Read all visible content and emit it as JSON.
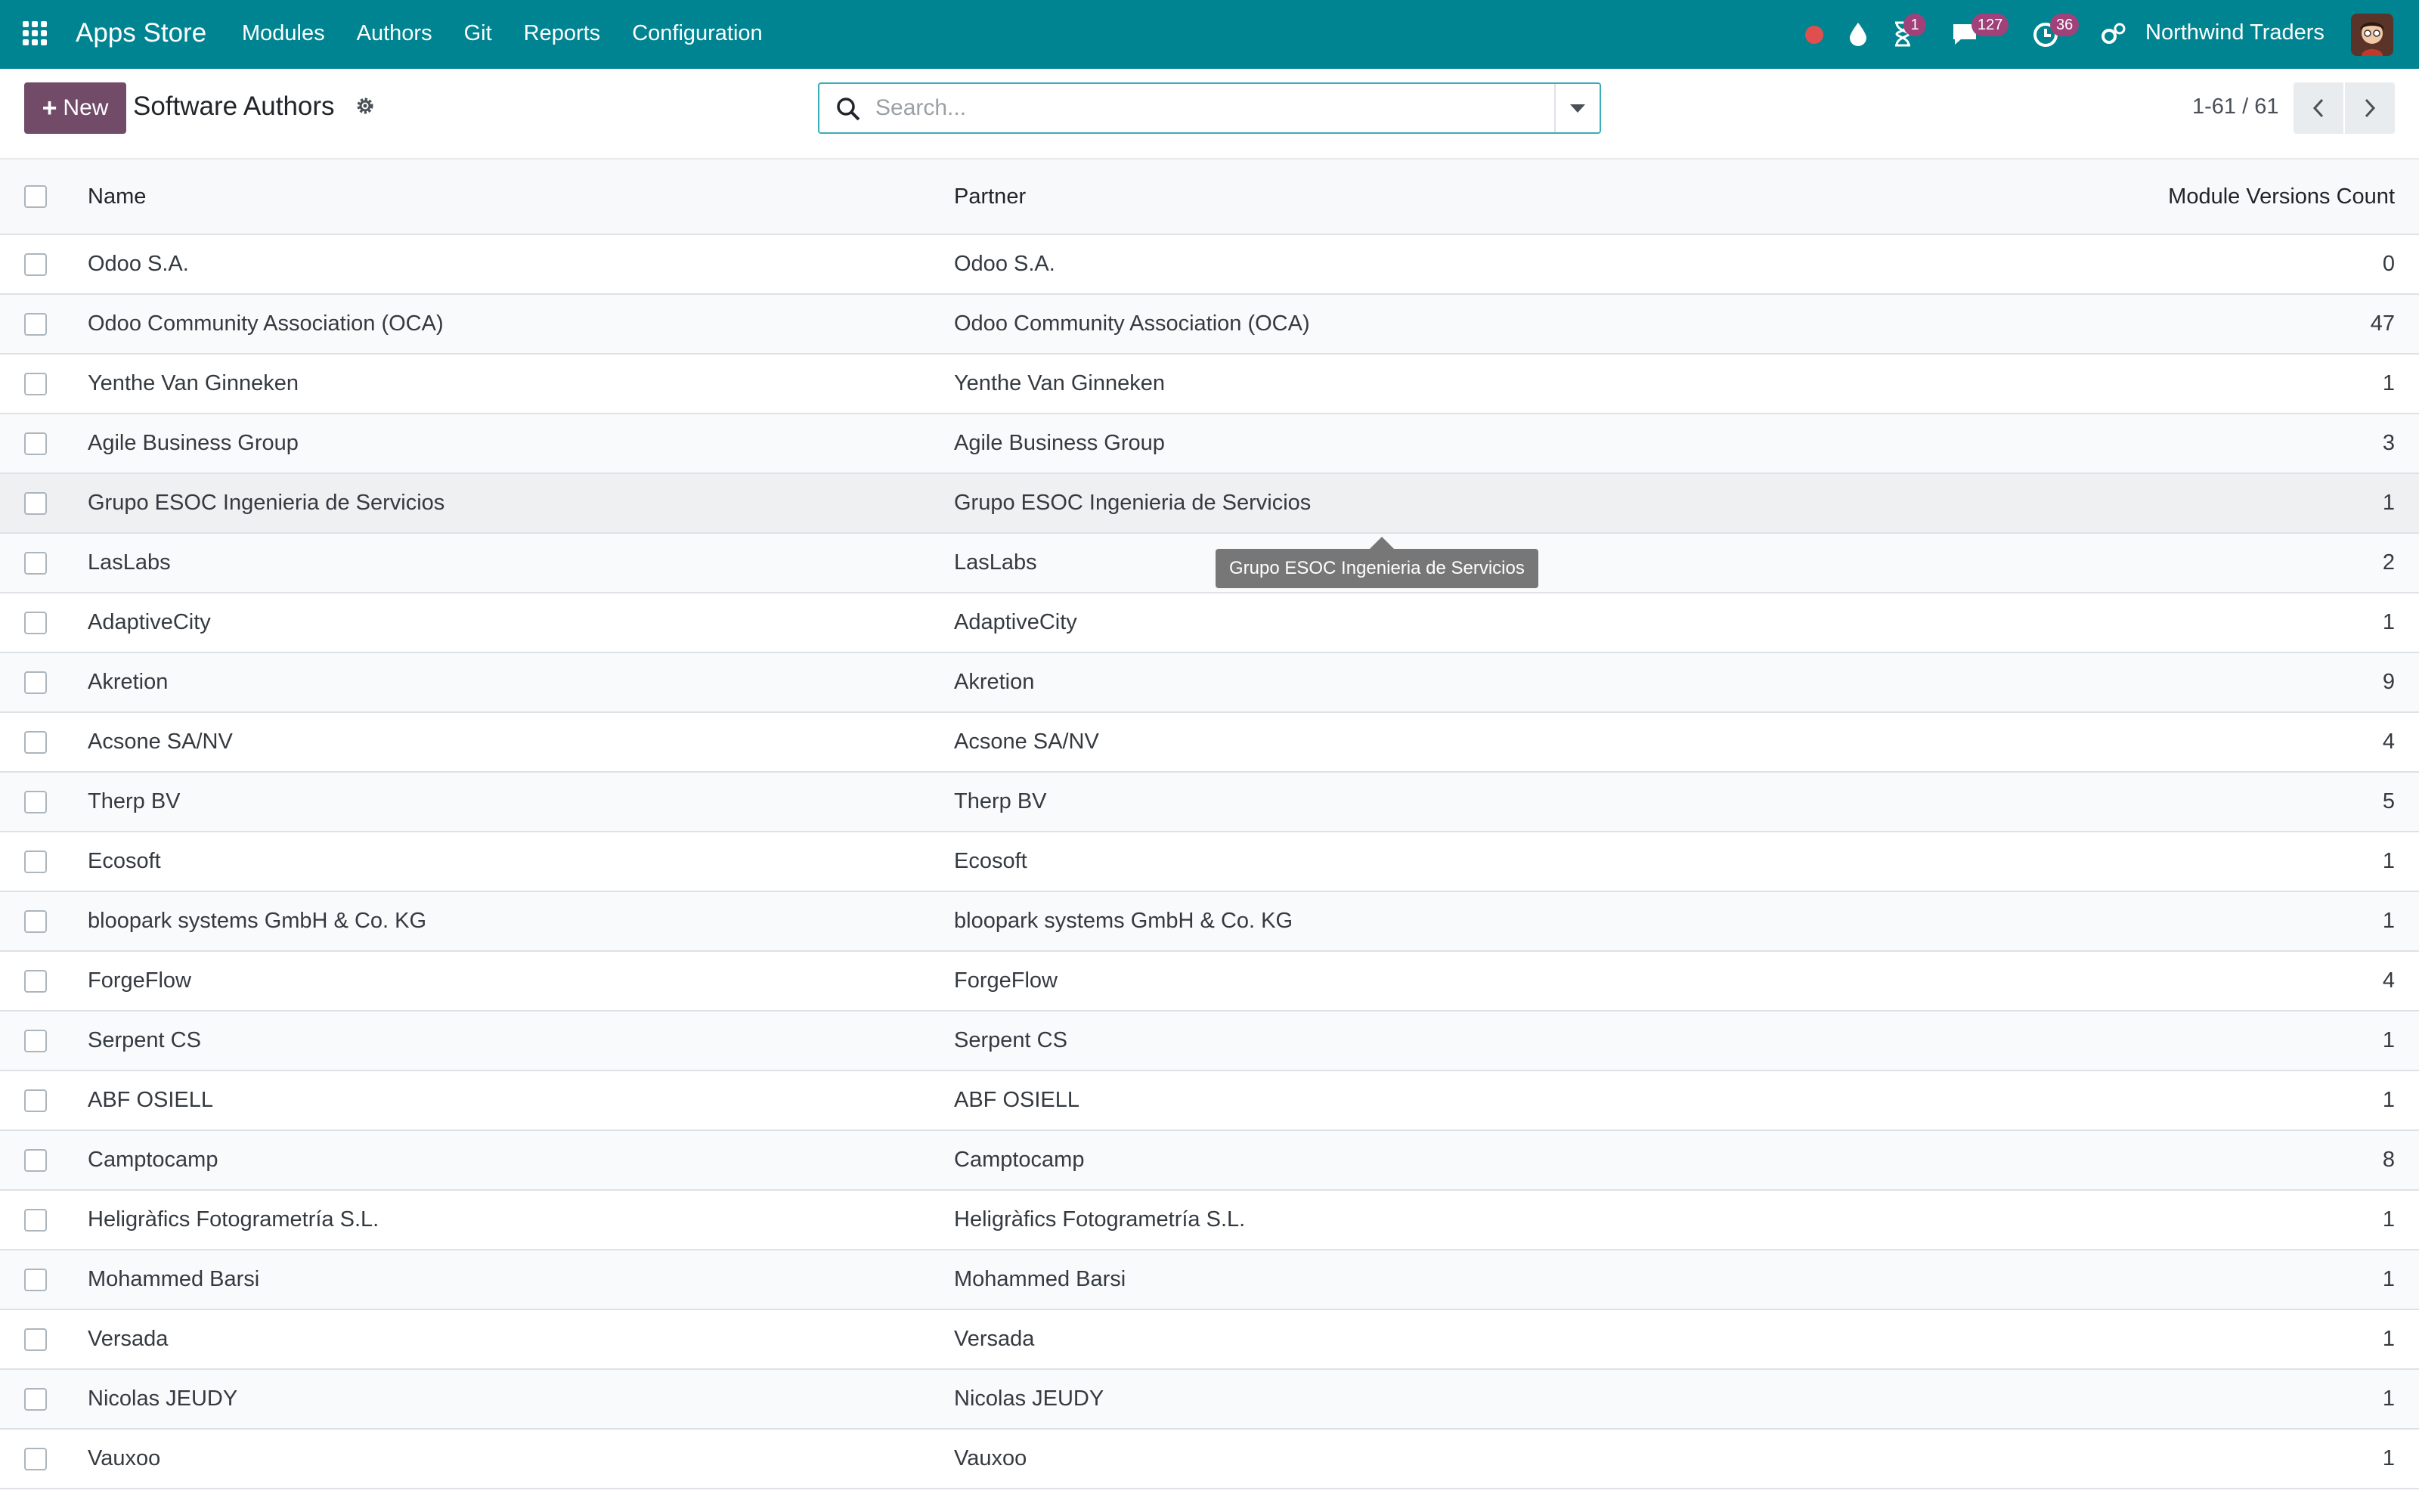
{
  "navbar": {
    "app_title": "Apps Store",
    "menu": [
      "Modules",
      "Authors",
      "Git",
      "Reports",
      "Configuration"
    ],
    "activity_badge": "1",
    "messages_badge": "127",
    "clock_badge": "36",
    "company": "Northwind Traders",
    "accent_color": "#008491"
  },
  "control": {
    "new_label": "New",
    "title": "Software Authors",
    "search_placeholder": "Search...",
    "pager": "1-61 / 61",
    "new_button_color": "#714b67"
  },
  "table": {
    "headers": {
      "name": "Name",
      "partner": "Partner",
      "count": "Module Versions Count"
    },
    "rows": [
      {
        "name": "Odoo S.A.",
        "partner": "Odoo S.A.",
        "count": "0"
      },
      {
        "name": "Odoo Community Association (OCA)",
        "partner": "Odoo Community Association (OCA)",
        "count": "47"
      },
      {
        "name": "Yenthe Van Ginneken",
        "partner": "Yenthe Van Ginneken",
        "count": "1"
      },
      {
        "name": "Agile Business Group",
        "partner": "Agile Business Group",
        "count": "3"
      },
      {
        "name": "Grupo ESOC Ingenieria de Servicios",
        "partner": "Grupo ESOC Ingenieria de Servicios",
        "count": "1"
      },
      {
        "name": "LasLabs",
        "partner": "LasLabs",
        "count": "2"
      },
      {
        "name": "AdaptiveCity",
        "partner": "AdaptiveCity",
        "count": "1"
      },
      {
        "name": "Akretion",
        "partner": "Akretion",
        "count": "9"
      },
      {
        "name": "Acsone SA/NV",
        "partner": "Acsone SA/NV",
        "count": "4"
      },
      {
        "name": "Therp BV",
        "partner": "Therp BV",
        "count": "5"
      },
      {
        "name": "Ecosoft",
        "partner": "Ecosoft",
        "count": "1"
      },
      {
        "name": "bloopark systems GmbH & Co. KG",
        "partner": "bloopark systems GmbH & Co. KG",
        "count": "1"
      },
      {
        "name": "ForgeFlow",
        "partner": "ForgeFlow",
        "count": "4"
      },
      {
        "name": "Serpent CS",
        "partner": "Serpent CS",
        "count": "1"
      },
      {
        "name": "ABF OSIELL",
        "partner": "ABF OSIELL",
        "count": "1"
      },
      {
        "name": "Camptocamp",
        "partner": "Camptocamp",
        "count": "8"
      },
      {
        "name": "Heligràfics Fotogrametría S.L.",
        "partner": "Heligràfics Fotogrametría S.L.",
        "count": "1"
      },
      {
        "name": "Mohammed Barsi",
        "partner": "Mohammed Barsi",
        "count": "1"
      },
      {
        "name": "Versada",
        "partner": "Versada",
        "count": "1"
      },
      {
        "name": "Nicolas JEUDY",
        "partner": "Nicolas JEUDY",
        "count": "1"
      },
      {
        "name": "Vauxoo",
        "partner": "Vauxoo",
        "count": "1"
      }
    ]
  },
  "tooltip": {
    "text": "Grupo ESOC Ingenieria de Servicios"
  }
}
